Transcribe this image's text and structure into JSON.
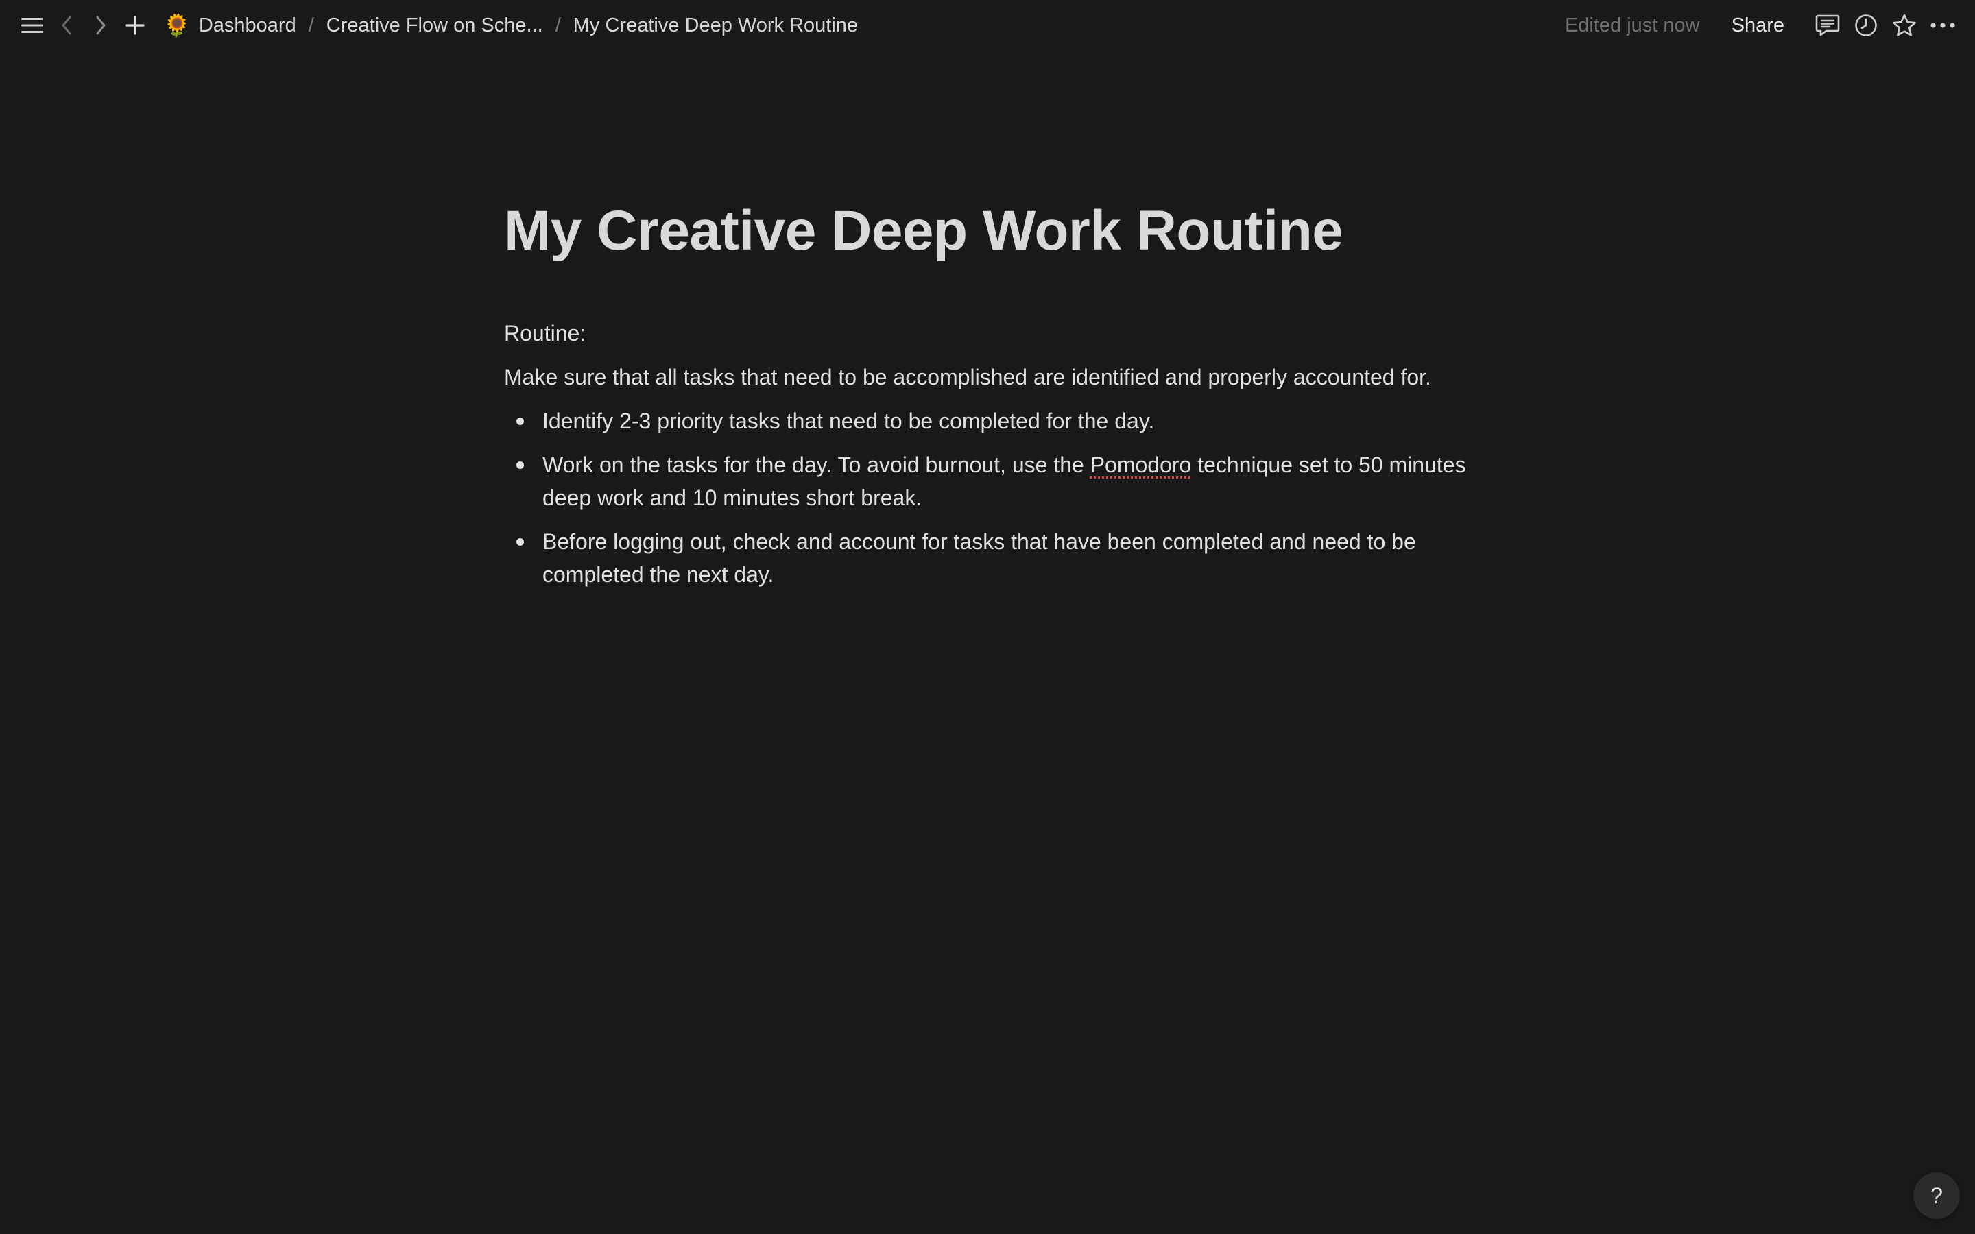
{
  "topbar": {
    "menu_icon": "menu-icon",
    "back_icon": "chevron-left-icon",
    "forward_icon": "chevron-right-icon",
    "new_icon": "plus-icon",
    "breadcrumb": [
      {
        "emoji": "🌻",
        "label": "Dashboard"
      },
      {
        "label": "Creative Flow on Sche..."
      },
      {
        "label": "My Creative Deep Work Routine"
      }
    ],
    "separator": "/",
    "edited_label": "Edited just now",
    "share_label": "Share",
    "right_icons": [
      "comment-icon",
      "history-clock-icon",
      "star-icon",
      "more-icon"
    ]
  },
  "page": {
    "title": "My Creative Deep Work Routine",
    "routine_label": "Routine:",
    "intro": "Make sure that all tasks that need to be accomplished are identified and properly accounted for.",
    "bullets": {
      "b0": "Identify 2-3 priority tasks that need to be completed for the day.",
      "b1_pre": "Work on the tasks for the day. To avoid burnout, use the ",
      "b1_word": "Pomodoro",
      "b1_post": " technique set to 50 minutes deep work and 10 minutes short break.",
      "b2": "Before logging out, check and account for tasks that have been completed and need to be completed the next day."
    }
  },
  "help_label": "?",
  "colors": {
    "background": "#191919",
    "text": "#e0e0e0",
    "muted": "#6f6f6f",
    "spellcheck": "#d04a4a"
  }
}
